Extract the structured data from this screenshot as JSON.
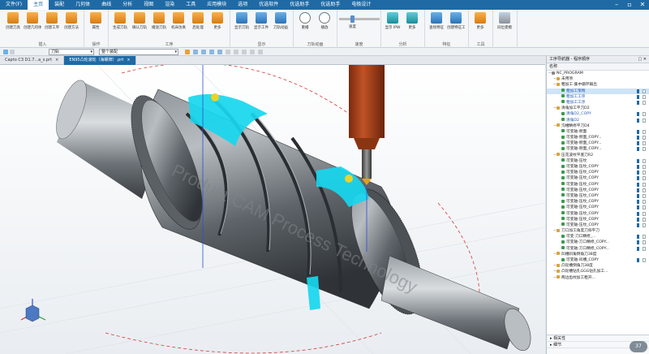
{
  "menu": {
    "items": [
      "文件(F)",
      "主页",
      "装配",
      "几何体",
      "曲线",
      "分析",
      "视图",
      "渲染",
      "工具",
      "应用模块",
      "选项",
      "优选软件",
      "优选助手",
      "优选助手",
      "电极设计"
    ],
    "active_index": 1
  },
  "ribbon": {
    "groups": [
      {
        "label": "插入",
        "buttons": [
          "创建刀具",
          "创建几何体",
          "创建工序",
          "创建方法"
        ]
      },
      {
        "label": "操作",
        "buttons": [
          "属性"
        ]
      },
      {
        "label": "工序",
        "buttons": [
          "生成刀轨",
          "确认刀轨",
          "播放刀轨",
          "机床仿真",
          "后处理",
          "更多"
        ]
      },
      {
        "label": "显示",
        "buttons": [
          "显示刀轨",
          "显示工件",
          "刀轨动画"
        ]
      },
      {
        "label": "刀轨动画",
        "buttons": [
          "重播",
          "播放"
        ]
      },
      {
        "label": "速度",
        "buttons": []
      },
      {
        "label": "分析",
        "buttons": [
          "显示 IPW",
          "更多"
        ]
      },
      {
        "label": "特征",
        "buttons": [
          "查找特征",
          "创建特征工艺"
        ]
      },
      {
        "label": "工具",
        "buttons": [
          "更多"
        ]
      },
      {
        "label": "",
        "buttons": [
          "同位建模"
        ]
      }
    ],
    "speed_label": "速度"
  },
  "selection_bar": {
    "filter_value": "刀轨",
    "scope_value": "整个装配"
  },
  "tabs": [
    {
      "label": "Capto C3 D1.7...a_s.prt",
      "active": false
    },
    {
      "label": "EN95凸轮滚轮（海螺牌）.prt",
      "active": true
    }
  ],
  "watermark": "Product CAM Process Technology",
  "navigator": {
    "title": "工序导航器 - 程序顺序",
    "column_header": "名称",
    "rows": [
      {
        "level": 0,
        "name": "NC_PROGRAM",
        "icon": "program",
        "selected": false
      },
      {
        "level": 1,
        "name": "未用项",
        "icon": "folder",
        "selected": false
      },
      {
        "level": 1,
        "name": "粗加工-集中循环输出",
        "icon": "folder",
        "selected": false
      },
      {
        "level": 2,
        "name": "粗加工策略",
        "icon": "op",
        "selected": true
      },
      {
        "level": 2,
        "name": "粗加工工序",
        "icon": "op",
        "selected": false
      },
      {
        "level": 2,
        "name": "粗加工工序",
        "icon": "op",
        "selected": false
      },
      {
        "level": 1,
        "name": "清角加工平刀D2",
        "icon": "folder",
        "selected": false
      },
      {
        "level": 2,
        "name": "清角D2_COPY",
        "icon": "op",
        "selected": false
      },
      {
        "level": 2,
        "name": "清角D2",
        "icon": "op",
        "selected": false
      },
      {
        "level": 1,
        "name": "沟槽精修平刀D4",
        "icon": "folder",
        "selected": false
      },
      {
        "level": 2,
        "name": "可变轴-侧面",
        "icon": "op",
        "selected": false
      },
      {
        "level": 2,
        "name": "可变轴-侧面_COPY...",
        "icon": "op",
        "selected": false
      },
      {
        "level": 2,
        "name": "可变轴-侧面_COPY...",
        "icon": "op",
        "selected": false
      },
      {
        "level": 2,
        "name": "可变轴-侧面_COPY...",
        "icon": "op",
        "selected": false
      },
      {
        "level": 1,
        "name": "压花波纹平底刀R2",
        "icon": "folder",
        "selected": false
      },
      {
        "level": 2,
        "name": "可变轴-压纹",
        "icon": "op",
        "selected": false
      },
      {
        "level": 2,
        "name": "可变轴-压纹_COPY",
        "icon": "op",
        "selected": false
      },
      {
        "level": 2,
        "name": "可变轴-压纹_COPY",
        "icon": "op",
        "selected": false
      },
      {
        "level": 2,
        "name": "可变轴-压纹_COPY",
        "icon": "op",
        "selected": false
      },
      {
        "level": 2,
        "name": "可变轴-压纹_COPY",
        "icon": "op",
        "selected": false
      },
      {
        "level": 2,
        "name": "可变轴-压纹_COPY",
        "icon": "op",
        "selected": false
      },
      {
        "level": 2,
        "name": "可变轴-压纹_COPY",
        "icon": "op",
        "selected": false
      },
      {
        "level": 2,
        "name": "可变轴-压纹_COPY",
        "icon": "op",
        "selected": false
      },
      {
        "level": 2,
        "name": "可变轴-压纹_COPY",
        "icon": "op",
        "selected": false
      },
      {
        "level": 2,
        "name": "可变轴-压纹_COPY",
        "icon": "op",
        "selected": false
      },
      {
        "level": 2,
        "name": "可变轴-压纹_COPY",
        "icon": "op",
        "selected": false
      },
      {
        "level": 2,
        "name": "可变轴-压纹_COPY",
        "icon": "op",
        "selected": false
      },
      {
        "level": 1,
        "name": "刀口加工角度刀斜平刀",
        "icon": "folder",
        "selected": false
      },
      {
        "level": 2,
        "name": "可变-刀口精修_...",
        "icon": "op",
        "selected": false
      },
      {
        "level": 2,
        "name": "可变轴-刀口精修_COPY...",
        "icon": "op",
        "selected": false
      },
      {
        "level": 2,
        "name": "可变轴-刀口精修_COPY...",
        "icon": "op",
        "selected": false
      },
      {
        "level": 1,
        "name": "凹槽斜角倒角刀38度",
        "icon": "folder",
        "selected": false
      },
      {
        "level": 2,
        "name": "可变轴-凹槽_COPY",
        "icon": "op",
        "selected": false
      },
      {
        "level": 1,
        "name": "凸轮槽倒角刀38度",
        "icon": "folder",
        "selected": false
      },
      {
        "level": 1,
        "name": "凸轮槽钻孔GGG钻孔加工...",
        "icon": "folder",
        "selected": false
      },
      {
        "level": 1,
        "name": "两边齿纹加工粗开...",
        "icon": "folder",
        "selected": false
      }
    ],
    "footer": [
      "相关性",
      "细节"
    ],
    "counter": "37"
  },
  "colors": {
    "brand": "#1f6aa5",
    "toolpath": "#17d7ee",
    "cutter": "#b5481d"
  }
}
